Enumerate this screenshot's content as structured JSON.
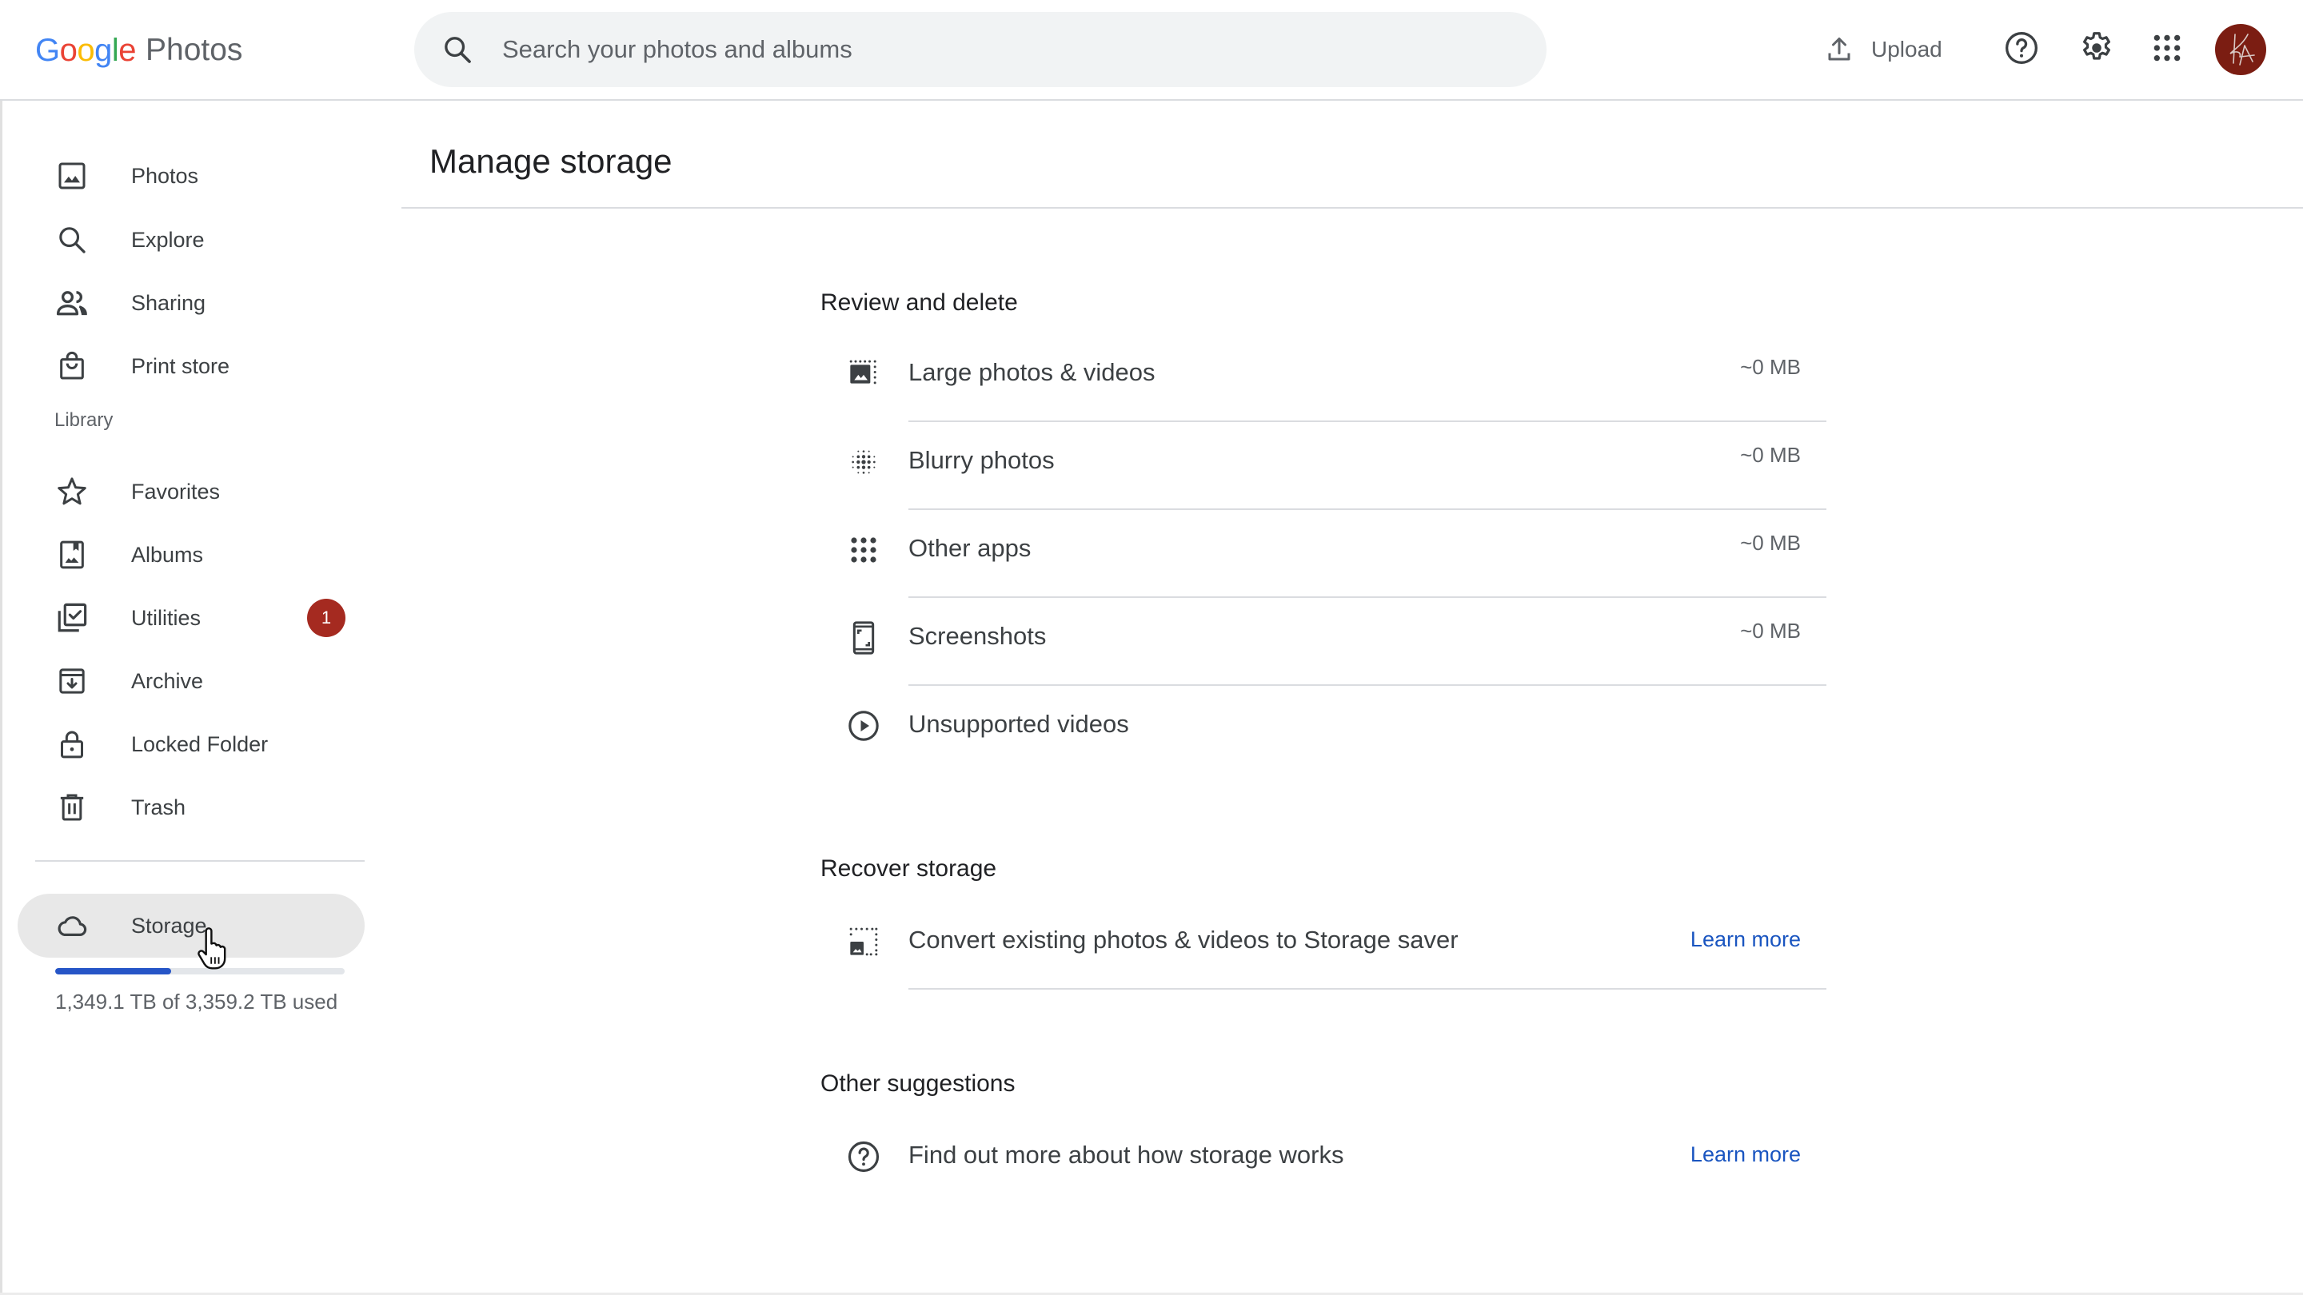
{
  "app": {
    "logo_google": [
      "G",
      "o",
      "o",
      "g",
      "l",
      "e"
    ],
    "logo_google_colors": [
      "#4285f4",
      "#ea4335",
      "#fbbc05",
      "#4285f4",
      "#34a853",
      "#ea4335"
    ],
    "logo_product": "Photos"
  },
  "header": {
    "search_placeholder": "Search your photos and albums",
    "search_value": "",
    "upload_label": "Upload",
    "help_icon": "help-circle-icon",
    "settings_icon": "gear-icon",
    "apps_icon": "apps-grid-icon",
    "avatar_initials": "KA",
    "avatar_color": "#7b1d12"
  },
  "sidebar": {
    "items": [
      {
        "label": "Photos",
        "icon": "photo-icon"
      },
      {
        "label": "Explore",
        "icon": "search-icon"
      },
      {
        "label": "Sharing",
        "icon": "people-icon"
      },
      {
        "label": "Print store",
        "icon": "shopping-bag-icon"
      }
    ],
    "library_label": "Library",
    "library_items": [
      {
        "label": "Favorites",
        "icon": "star-icon"
      },
      {
        "label": "Albums",
        "icon": "album-icon"
      },
      {
        "label": "Utilities",
        "icon": "utilities-icon",
        "badge": "1"
      },
      {
        "label": "Archive",
        "icon": "archive-icon"
      },
      {
        "label": "Locked Folder",
        "icon": "lock-icon"
      },
      {
        "label": "Trash",
        "icon": "trash-icon"
      }
    ],
    "storage": {
      "label": "Storage",
      "icon": "cloud-icon",
      "used_text": "1,349.1 TB of 3,359.2 TB used",
      "used_fraction": 0.4016,
      "bar_color": "#2655c7"
    }
  },
  "main": {
    "title": "Manage storage",
    "sections": [
      {
        "title": "Review and delete",
        "rows": [
          {
            "label": "Large photos & videos",
            "value": "~0 MB",
            "icon": "large-photo-icon"
          },
          {
            "label": "Blurry photos",
            "value": "~0 MB",
            "icon": "blur-icon"
          },
          {
            "label": "Other apps",
            "value": "~0 MB",
            "icon": "apps-grid-icon"
          },
          {
            "label": "Screenshots",
            "value": "~0 MB",
            "icon": "screenshot-icon"
          },
          {
            "label": "Unsupported videos",
            "value": "",
            "icon": "play-circle-icon"
          }
        ]
      },
      {
        "title": "Recover storage",
        "rows": [
          {
            "label": "Convert existing photos & videos to Storage saver",
            "link": "Learn more",
            "icon": "storage-saver-icon"
          }
        ]
      },
      {
        "title": "Other suggestions",
        "rows": [
          {
            "label": "Find out more about how storage works",
            "link": "Learn more",
            "icon": "help-circle-icon"
          }
        ]
      }
    ]
  }
}
